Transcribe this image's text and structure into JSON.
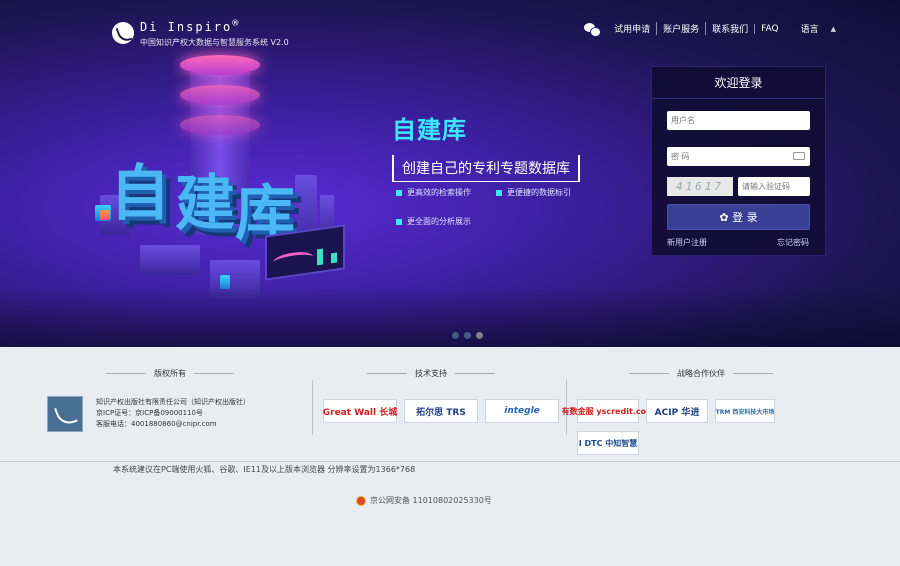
{
  "brand": {
    "name": "Di Inspiro",
    "reg_mark": "®",
    "subtitle": "中国知识产权大数据与智慧服务系统 V2.0"
  },
  "topnav": {
    "items": [
      "试用申请",
      "账户服务",
      "联系我们",
      "FAQ"
    ],
    "language": "语言"
  },
  "hero": {
    "big_text": [
      "自",
      "建",
      "库"
    ],
    "title": "自建库",
    "subtitle": "创建自己的专利专题数据库",
    "features": [
      "更高效的检索操作",
      "更便捷的数据标引",
      "更全面的分析展示"
    ]
  },
  "login": {
    "title": "欢迎登录",
    "username_placeholder": "用户名",
    "password_placeholder": "密 码",
    "captcha_text": "41617",
    "captcha_placeholder": "请输入验证码",
    "login_label": "登 录",
    "register_label": "新用户注册",
    "forgot_label": "忘记密码"
  },
  "footer": {
    "copyright_title": "版权所有",
    "copyright_lines": [
      "知识产权出版社有限责任公司（知识产权出版社）",
      "京ICP证号：京ICP备09000110号",
      "客服电话：4001880860@cnipr.com"
    ],
    "tech_title": "技术支持",
    "tech_partners": [
      "Great Wall 长城",
      "拓尔思 TRS",
      "integle"
    ],
    "strategy_title": "战略合作伙伴",
    "strategy_partners": [
      "有数金服 yscredit.com",
      "ACIP 华进",
      "TRM 西安科技大市场",
      "I DTC 中知智慧"
    ],
    "notice": "本系统建议在PC端使用火狐、谷歌、IE11及以上版本浏览器 分辨率设置为1366*768",
    "icp": "京公网安备 11010802025330号"
  },
  "colors": {
    "hero_bg": "#1d1550",
    "accent_cyan": "#3ee6ff",
    "login_button": "#3a3f96"
  }
}
